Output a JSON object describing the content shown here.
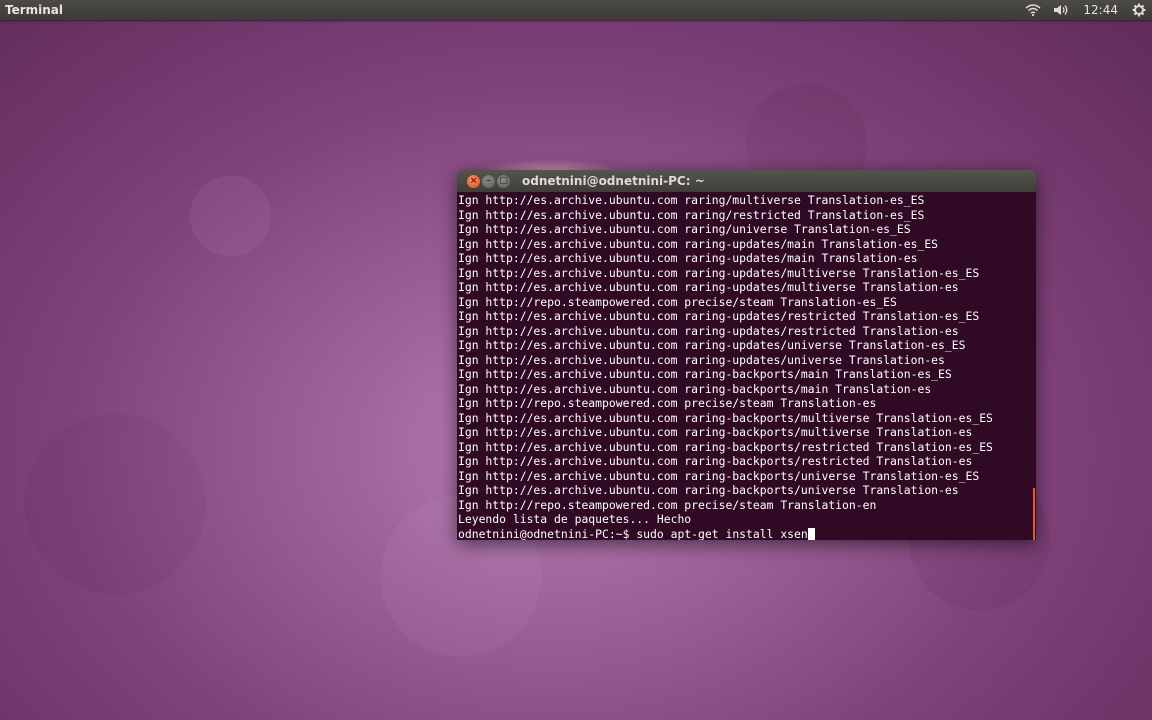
{
  "topbar": {
    "app_title": "Terminal",
    "clock": "12:44",
    "icons": [
      "wifi-icon",
      "volume-icon",
      "gear-icon"
    ]
  },
  "terminal": {
    "title": "odnetnini@odnetnini-PC: ~",
    "lines": [
      "Ign http://es.archive.ubuntu.com raring/multiverse Translation-es_ES",
      "Ign http://es.archive.ubuntu.com raring/restricted Translation-es_ES",
      "Ign http://es.archive.ubuntu.com raring/universe Translation-es_ES",
      "Ign http://es.archive.ubuntu.com raring-updates/main Translation-es_ES",
      "Ign http://es.archive.ubuntu.com raring-updates/main Translation-es",
      "Ign http://es.archive.ubuntu.com raring-updates/multiverse Translation-es_ES",
      "Ign http://es.archive.ubuntu.com raring-updates/multiverse Translation-es",
      "Ign http://repo.steampowered.com precise/steam Translation-es_ES",
      "Ign http://es.archive.ubuntu.com raring-updates/restricted Translation-es_ES",
      "Ign http://es.archive.ubuntu.com raring-updates/restricted Translation-es",
      "Ign http://es.archive.ubuntu.com raring-updates/universe Translation-es_ES",
      "Ign http://es.archive.ubuntu.com raring-updates/universe Translation-es",
      "Ign http://es.archive.ubuntu.com raring-backports/main Translation-es_ES",
      "Ign http://es.archive.ubuntu.com raring-backports/main Translation-es",
      "Ign http://repo.steampowered.com precise/steam Translation-es",
      "Ign http://es.archive.ubuntu.com raring-backports/multiverse Translation-es_ES",
      "Ign http://es.archive.ubuntu.com raring-backports/multiverse Translation-es",
      "Ign http://es.archive.ubuntu.com raring-backports/restricted Translation-es_ES",
      "Ign http://es.archive.ubuntu.com raring-backports/restricted Translation-es",
      "Ign http://es.archive.ubuntu.com raring-backports/universe Translation-es_ES",
      "Ign http://es.archive.ubuntu.com raring-backports/universe Translation-es",
      "Ign http://repo.steampowered.com precise/steam Translation-en",
      "Leyendo lista de paquetes... Hecho"
    ],
    "prompt": "odnetnini@odnetnini-PC:~$ ",
    "command": "sudo apt-get install xsen",
    "buttons": {
      "close": "×",
      "minimize": "–",
      "maximize": "□"
    }
  },
  "colors": {
    "terminal_bg": "#300a24",
    "panel_bg": "#3c3b37",
    "close_button": "#df4a16",
    "scroll_indicator": "#e35d2a"
  }
}
